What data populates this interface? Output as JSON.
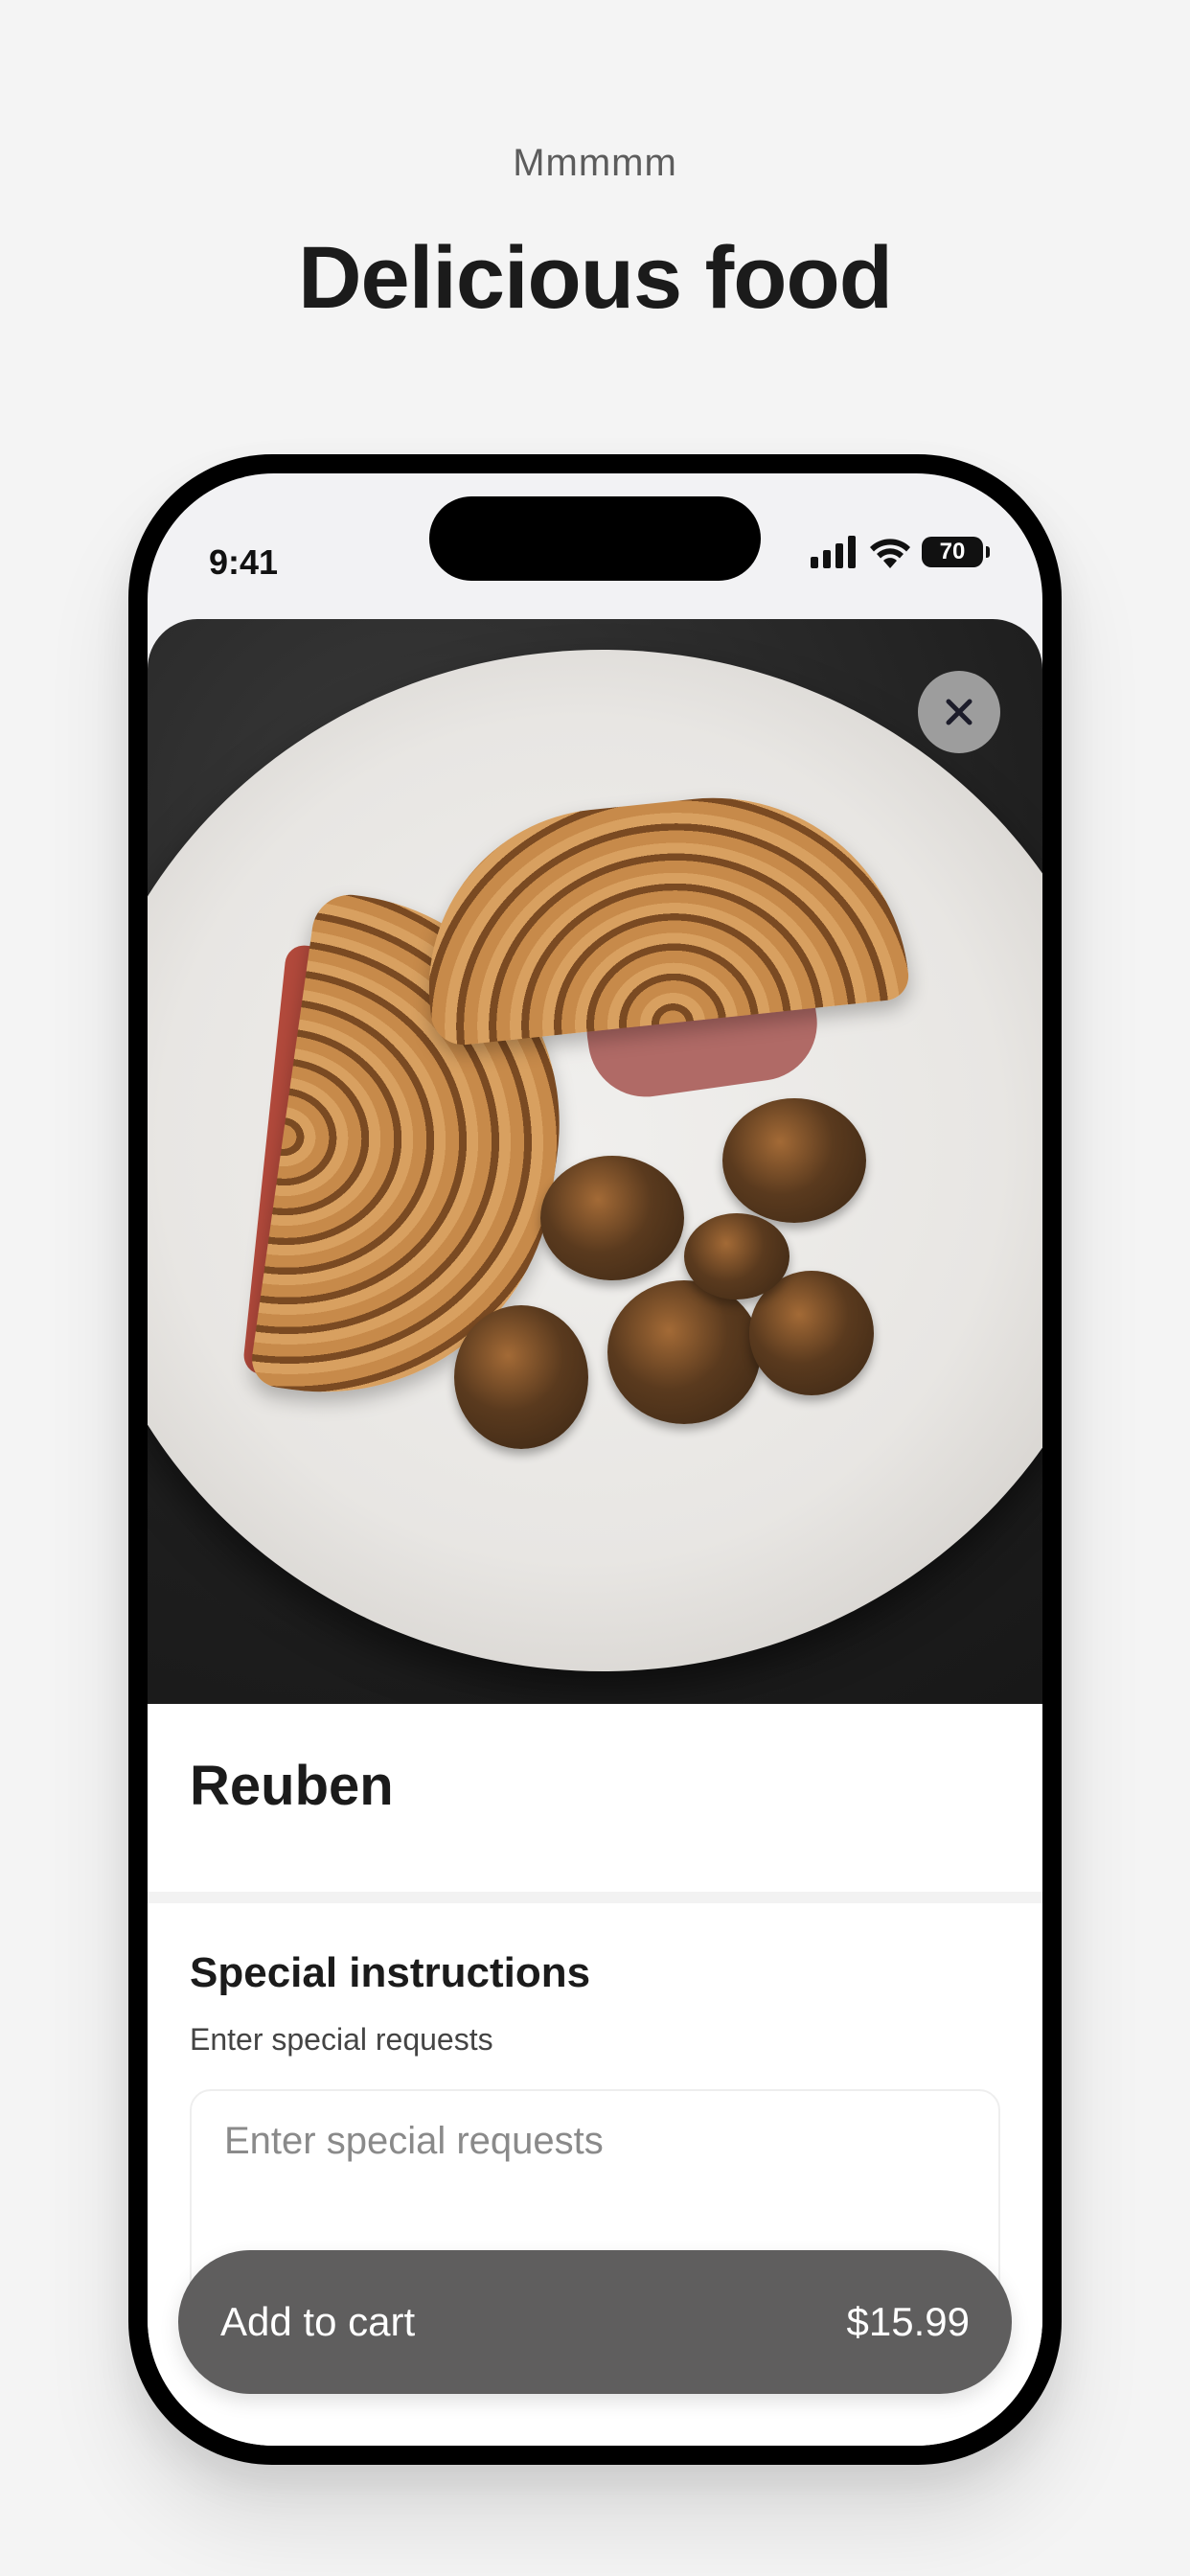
{
  "header": {
    "eyebrow": "Mmmmm",
    "title": "Delicious food"
  },
  "status_bar": {
    "time": "9:41",
    "battery": "70",
    "icons": [
      "signal-icon",
      "wifi-icon",
      "battery-icon"
    ]
  },
  "item": {
    "name": "Reuben",
    "close_icon": "close-icon"
  },
  "instructions": {
    "title": "Special instructions",
    "helper": "Enter special requests",
    "placeholder": "Enter special requests"
  },
  "cart": {
    "label": "Add to cart",
    "price": "$15.99"
  },
  "colors": {
    "background": "#f4f4f4",
    "cart_button": "#5f5e5e",
    "close_button": "#a8a8a8"
  }
}
